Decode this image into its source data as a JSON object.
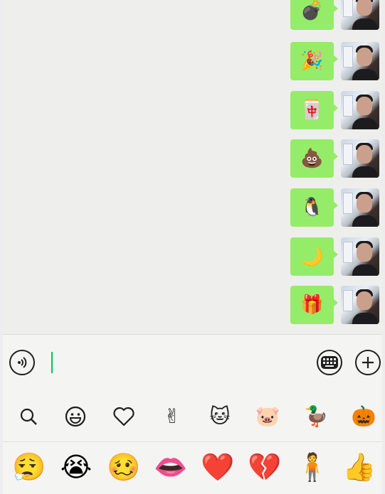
{
  "chat": {
    "messages": [
      {
        "emoji": "💣",
        "icon": "bomb-sticker"
      },
      {
        "emoji": "🎉",
        "icon": "party-popper-sticker"
      },
      {
        "emoji": "🀄",
        "icon": "mahjong-fa-tile-sticker"
      },
      {
        "emoji": "💩",
        "icon": "poop-sticker"
      },
      {
        "emoji": "🐧",
        "icon": "penguin-sticker"
      },
      {
        "emoji": "🌙",
        "icon": "moon-sticker"
      },
      {
        "emoji": "🎁",
        "icon": "gift-sticker"
      }
    ]
  },
  "input_bar": {
    "voice_icon": "voice-input-icon",
    "keyboard_icon": "keyboard-icon",
    "plus_icon": "plus-icon",
    "accent_color": "#07c160"
  },
  "sticker_tabs": [
    {
      "glyph": "🔍",
      "icon": "search-icon"
    },
    {
      "glyph": "😀",
      "icon": "smiley-icon"
    },
    {
      "glyph": "♡",
      "icon": "heart-outline-icon"
    },
    {
      "glyph": "✌",
      "icon": "victory-hand-icon"
    },
    {
      "glyph": "🐱",
      "icon": "lucky-cat-sticker-pack-icon"
    },
    {
      "glyph": "🐷",
      "icon": "pig-sticker-pack-icon"
    },
    {
      "glyph": "🦆",
      "icon": "duck-sticker-pack-icon"
    },
    {
      "glyph": "🎃",
      "icon": "pumpkin-sticker-pack-icon"
    }
  ],
  "emoji_row": [
    {
      "glyph": "😮‍💨",
      "icon": "sigh-face-emoji"
    },
    {
      "glyph": "😭",
      "icon": "crying-face-emoji"
    },
    {
      "glyph": "🥴",
      "icon": "cracked-face-emoji"
    },
    {
      "glyph": "👄",
      "icon": "lips-emoji"
    },
    {
      "glyph": "❤️",
      "icon": "red-heart-emoji"
    },
    {
      "glyph": "💔",
      "icon": "broken-heart-emoji"
    },
    {
      "glyph": "🧍",
      "icon": "green-figure-emoji"
    },
    {
      "glyph": "👍",
      "icon": "thumbs-up-emoji"
    }
  ],
  "colors": {
    "bubble": "#95ec69",
    "background": "#ededed"
  }
}
